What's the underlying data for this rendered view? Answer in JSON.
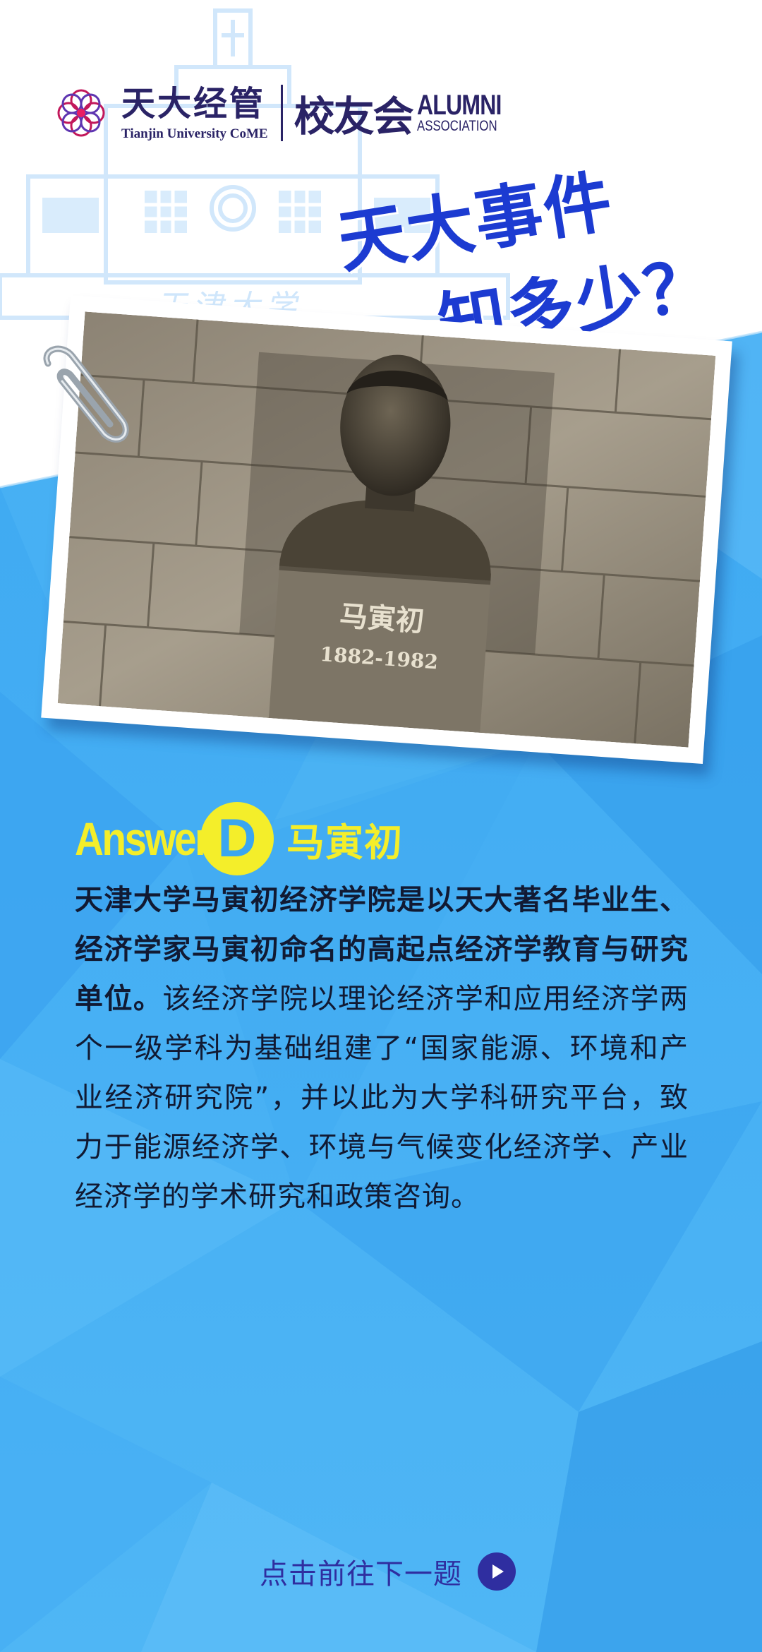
{
  "header": {
    "logo_cn": "天大经管",
    "logo_en": "Tianjin University CoME",
    "club": "校友会",
    "alumni_line1": "ALUMNI",
    "alumni_line2": "ASSOCIATION"
  },
  "headline": {
    "line1": "天大事件",
    "line2": "知多少？"
  },
  "background": {
    "building_sign": "天津大学"
  },
  "photo": {
    "plaque_name": "马寅初",
    "plaque_years": "1882-1982"
  },
  "answer": {
    "label": "Answer",
    "letter": "D",
    "name": "马寅初"
  },
  "body": {
    "bold_part": "天津大学马寅初经济学院是以天大著名毕业生、经济学家马寅初命名的高起点经济学教育与研究单位。",
    "regular_part": "该经济学院以理论经济学和应用经济学两个一级学科为基础组建了“国家能源、环境和产业经济研究院”，并以此为大学科研究平台，致力于能源经济学、环境与气候变化经济学、产业经济学的学术研究和政策咨询。"
  },
  "footer": {
    "next_label": "点击前往下一题"
  },
  "colors": {
    "brand_navy": "#2a2366",
    "headline_blue": "#1c3bd1",
    "answer_yellow": "#f4ee2a",
    "bg_blue": "#3aa6f0"
  }
}
